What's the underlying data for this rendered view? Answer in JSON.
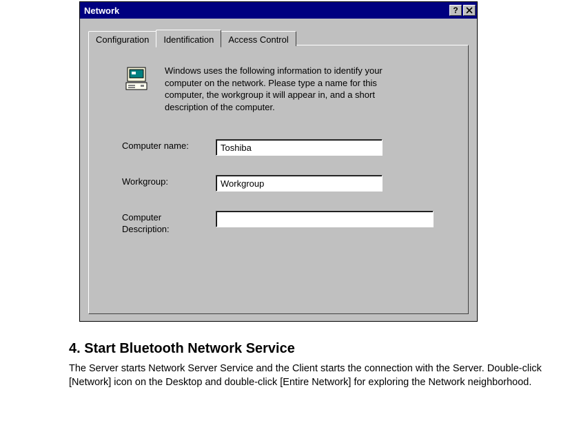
{
  "dialog": {
    "title": "Network",
    "help_glyph": "?",
    "close_glyph": "×",
    "tabs": {
      "configuration": "Configuration",
      "identification": "Identification",
      "access_control": "Access Control"
    },
    "intro": "Windows uses the following information to identify your computer on the network.  Please type a name for this computer, the workgroup it will appear in, and a short description of the computer.",
    "fields": {
      "computer_name": {
        "label": "Computer name:",
        "value": "Toshiba"
      },
      "workgroup": {
        "label": "Workgroup:",
        "value": "Workgroup"
      },
      "description": {
        "label": "Computer Description:",
        "value": ""
      }
    }
  },
  "doc": {
    "heading": "4. Start Bluetooth Network Service",
    "paragraph": "The Server starts Network Server Service and the Client starts the connection with the Server. Double-click [Network] icon on the Desktop and double-click [Entire Network] for exploring the Network neighborhood."
  }
}
